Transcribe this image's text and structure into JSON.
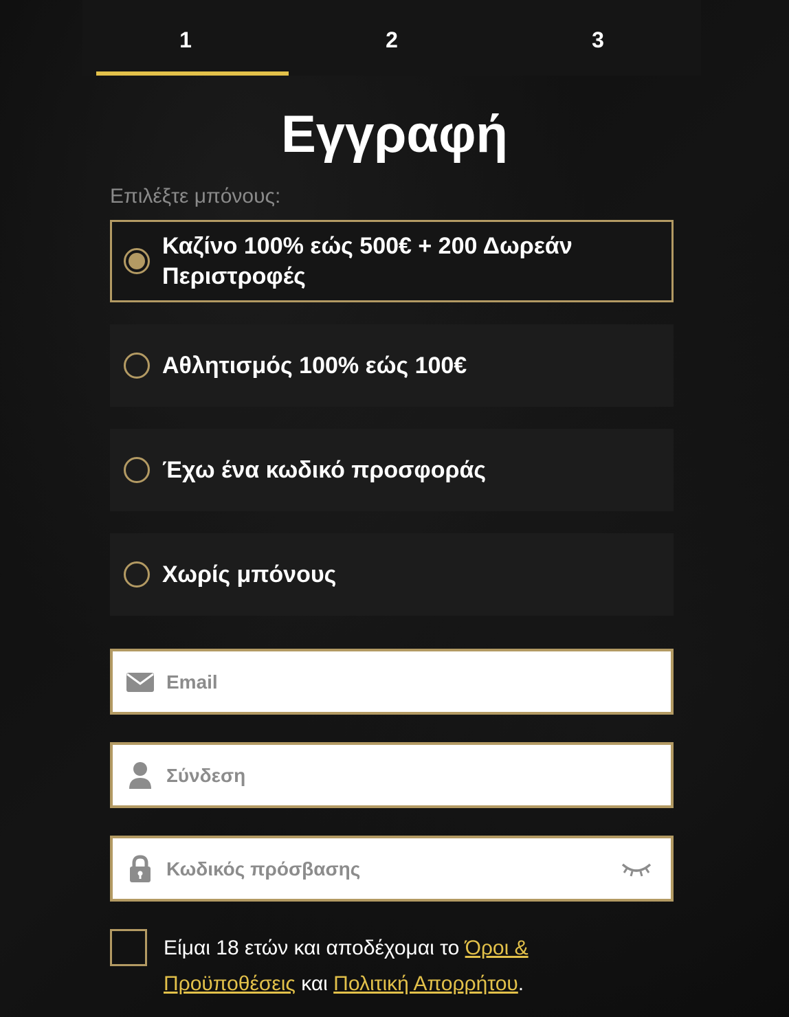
{
  "steps": [
    "1",
    "2",
    "3"
  ],
  "title": "Εγγραφή",
  "subtitle": "Επιλέξτε μπόνους:",
  "bonuses": [
    {
      "label": "Καζίνο 100% εώς 500€ + 200 Δωρεάν Περιστροφές",
      "selected": true
    },
    {
      "label": "Αθλητισμός 100% εώς 100€",
      "selected": false
    },
    {
      "label": "Έχω ένα κωδικό προσφοράς",
      "selected": false
    },
    {
      "label": "Χωρίς μπόνους",
      "selected": false
    }
  ],
  "fields": {
    "email": {
      "placeholder": "Email",
      "value": ""
    },
    "login": {
      "placeholder": "Σύνδεση",
      "value": ""
    },
    "password": {
      "placeholder": "Κωδικός πρόσβασης",
      "value": ""
    }
  },
  "terms": {
    "text_before": "Είμαι 18 ετών και αποδέχομαι το ",
    "terms_link": "Όροι & Προϋποθέσεις",
    "text_middle": " και ",
    "privacy_link": "Πολιτική Απορρήτου",
    "text_after": ".",
    "checked": false
  },
  "colors": {
    "accent_gold": "#b39a63",
    "tab_underline": "#e3c14a",
    "link": "#e3c14a",
    "background": "#0b0b0b"
  },
  "icons": {
    "email": "envelope-icon",
    "login": "user-icon",
    "password": "lock-icon",
    "toggle": "eye-closed-icon"
  }
}
